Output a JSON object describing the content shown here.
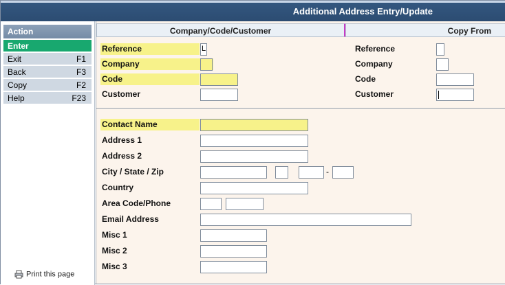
{
  "window": {
    "title": "Additional Address Entry/Update"
  },
  "sidebar": {
    "header": "Action",
    "items": [
      {
        "label": "Enter",
        "key": ""
      },
      {
        "label": "Exit",
        "key": "F1"
      },
      {
        "label": "Back",
        "key": "F3"
      },
      {
        "label": "Copy",
        "key": "F2"
      },
      {
        "label": "Help",
        "key": "F23"
      }
    ],
    "print_label": "Print this page"
  },
  "main": {
    "left_header": "Company/Code/Customer",
    "right_header": "Copy From",
    "left_fields": {
      "reference": {
        "label": "Reference",
        "value": "L"
      },
      "company": {
        "label": "Company",
        "value": ""
      },
      "code": {
        "label": "Code",
        "value": ""
      },
      "customer": {
        "label": "Customer",
        "value": ""
      }
    },
    "right_fields": {
      "reference": {
        "label": "Reference",
        "value": ""
      },
      "company": {
        "label": "Company",
        "value": ""
      },
      "code": {
        "label": "Code",
        "value": ""
      },
      "customer": {
        "label": "Customer",
        "value": ""
      }
    },
    "address": {
      "contact_name": {
        "label": "Contact Name",
        "value": ""
      },
      "address1": {
        "label": "Address 1",
        "value": ""
      },
      "address2": {
        "label": "Address 2",
        "value": ""
      },
      "city_state_zip": {
        "label": "City / State / Zip",
        "city": "",
        "state": "",
        "zip1": "",
        "zip2": "",
        "separator": "-"
      },
      "country": {
        "label": "Country",
        "value": ""
      },
      "phone": {
        "label": "Area Code/Phone",
        "area": "",
        "number": ""
      },
      "email": {
        "label": "Email Address",
        "value": ""
      },
      "misc1": {
        "label": "Misc 1",
        "value": ""
      },
      "misc2": {
        "label": "Misc 2",
        "value": ""
      },
      "misc3": {
        "label": "Misc 3",
        "value": ""
      }
    }
  },
  "colors": {
    "title_bar": "#2c4c72",
    "highlight": "#f7f28a",
    "enter_button": "#18a86f",
    "panel_background": "#fcf4ec"
  }
}
